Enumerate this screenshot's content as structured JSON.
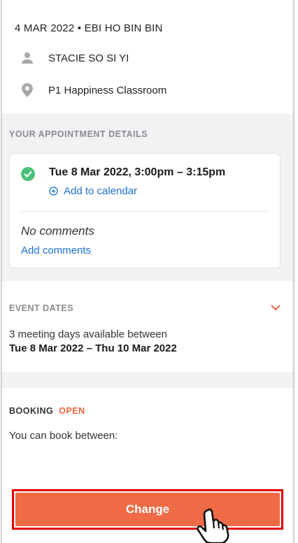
{
  "header": {
    "meta": "4 MAR 2022 • EBI HO BIN BIN",
    "person": "STACIE SO SI YI",
    "location": "P1 Happiness Classroom"
  },
  "appointment": {
    "section_label": "YOUR APPOINTMENT DETAILS",
    "time": "Tue 8 Mar 2022, 3:00pm – 3:15pm",
    "add_calendar": "Add to calendar",
    "no_comments": "No comments",
    "add_comments": "Add comments"
  },
  "event_dates": {
    "section_label": "EVENT DATES",
    "text": "3 meeting days available between",
    "range": "Tue 8 Mar 2022 – Thu 10 Mar 2022"
  },
  "booking": {
    "section_label": "BOOKING",
    "status": "OPEN",
    "text": "You can book between:"
  },
  "actions": {
    "change_label": "Change"
  },
  "colors": {
    "accent": "#ee6b45",
    "link": "#1b6fd1",
    "success": "#4cc17d",
    "highlight_border": "#e00000"
  },
  "icons": [
    "person-icon",
    "location-pin-icon",
    "check-circle-icon",
    "plus-circle-icon",
    "chevron-down-icon",
    "pointing-hand-icon"
  ]
}
